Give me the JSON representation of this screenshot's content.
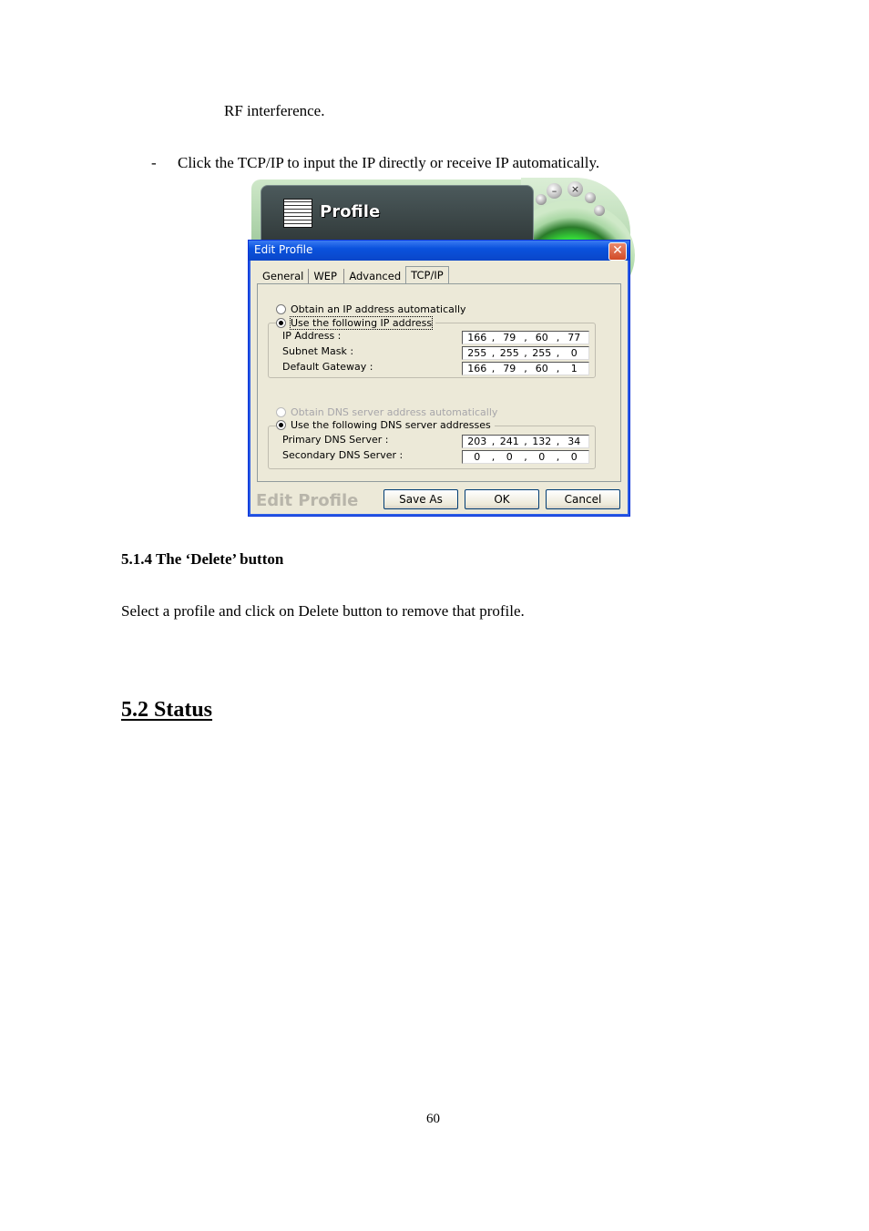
{
  "document": {
    "line_rf": "RF interference.",
    "bullet_dash": "-",
    "bullet_text": "Click the TCP/IP to input the IP directly or receive IP automatically.",
    "heading_delete": "5.1.4 The ‘Delete’ button",
    "delete_desc": "Select a profile and click on Delete button to remove that profile.",
    "heading_status": "5.2 Status",
    "page_number": "60"
  },
  "background_app": {
    "title": "Profile",
    "minimize_glyph": "–",
    "close_glyph": "×"
  },
  "dialog": {
    "title": "Edit Profile",
    "close_glyph": "✕",
    "tabs": [
      {
        "label": "General",
        "active": false
      },
      {
        "label": "WEP",
        "active": false
      },
      {
        "label": "Advanced",
        "active": false
      },
      {
        "label": "TCP/IP",
        "active": true
      }
    ],
    "ip_section": {
      "auto_label": "Obtain an IP address automatically",
      "manual_label": "Use the following IP address",
      "selected": "manual",
      "fields": [
        {
          "label": "IP Address :",
          "octets": [
            "166",
            "79",
            "60",
            "77"
          ]
        },
        {
          "label": "Subnet Mask :",
          "octets": [
            "255",
            "255",
            "255",
            "0"
          ]
        },
        {
          "label": "Default Gateway :",
          "octets": [
            "166",
            "79",
            "60",
            "1"
          ]
        }
      ]
    },
    "dns_section": {
      "auto_label": "Obtain DNS server address automatically",
      "auto_disabled": true,
      "manual_label": "Use the following DNS server addresses",
      "selected": "manual",
      "fields": [
        {
          "label": "Primary DNS Server :",
          "octets": [
            "203",
            "241",
            "132",
            "34"
          ]
        },
        {
          "label": "Secondary DNS Server :",
          "octets": [
            "0",
            "0",
            "0",
            "0"
          ]
        }
      ]
    },
    "footer_title": "Edit Profile",
    "buttons": {
      "save_as": "Save As",
      "ok": "OK",
      "cancel": "Cancel"
    }
  }
}
